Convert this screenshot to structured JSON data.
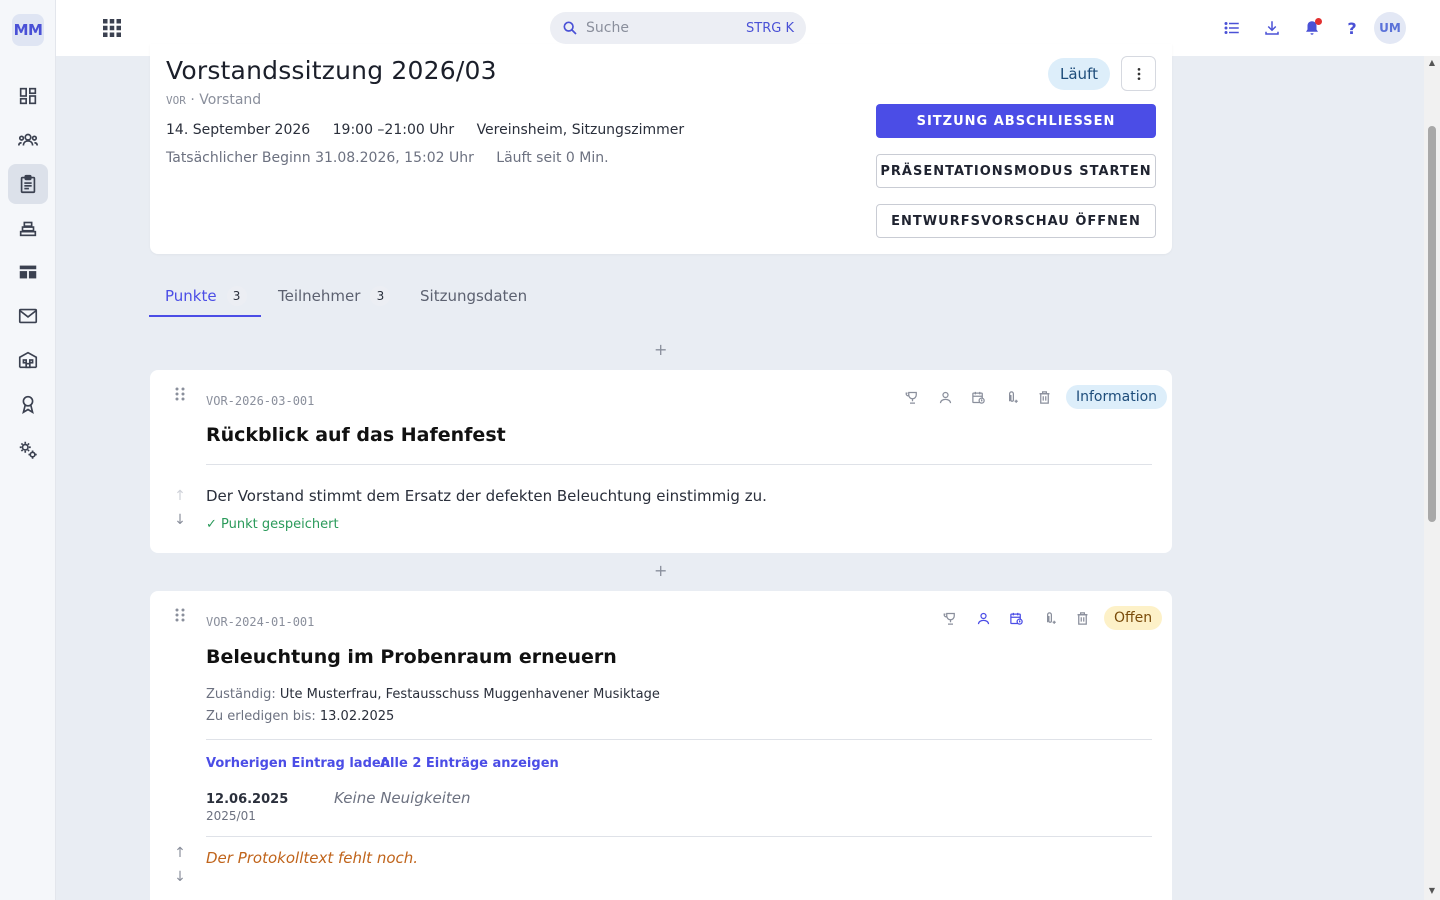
{
  "app": {
    "logo": "MM"
  },
  "sidebar": {
    "items": [
      {
        "name": "dashboard",
        "icon": "dashboard-icon"
      },
      {
        "name": "members",
        "icon": "people-icon"
      },
      {
        "name": "meetings",
        "icon": "clipboard-icon",
        "active": true
      },
      {
        "name": "inventory",
        "icon": "stack-icon"
      },
      {
        "name": "tables",
        "icon": "table-icon"
      },
      {
        "name": "mail",
        "icon": "mail-icon"
      },
      {
        "name": "buildings",
        "icon": "building-icon"
      },
      {
        "name": "awards",
        "icon": "award-icon"
      },
      {
        "name": "settings",
        "icon": "gear-icon"
      }
    ]
  },
  "topbar": {
    "search_placeholder": "Suche",
    "search_shortcut": "STRG K",
    "help": "?",
    "avatar": "UM"
  },
  "meeting": {
    "title": "Vorstandssitzung 2026/03",
    "code": "VOR",
    "group": "· Vorstand",
    "date": "14. September 2026",
    "time": "19:00 –21:00 Uhr",
    "location": "Vereinsheim, Sitzungszimmer",
    "actual_start": "Tatsächlicher Beginn 31.08.2026, 15:02 Uhr",
    "running_since": "Läuft seit 0 Min.",
    "status": "Läuft",
    "buttons": {
      "close": "SITZUNG ABSCHLIESSEN",
      "presentation": "PRÄSENTATIONSMODUS STARTEN",
      "preview": "ENTWURFSVORSCHAU ÖFFNEN"
    }
  },
  "tabs": [
    {
      "label": "Punkte",
      "count": "3"
    },
    {
      "label": "Teilnehmer",
      "count": "3"
    },
    {
      "label": "Sitzungsdaten"
    }
  ],
  "items": [
    {
      "code": "VOR-2026-03-001",
      "title": "Rückblick auf das Hafenfest",
      "tag": "Information",
      "text": "Der Vorstand stimmt dem Ersatz der defekten Beleuchtung einstimmig zu.",
      "saved": "✓ Punkt gespeichert"
    },
    {
      "code": "VOR-2024-01-001",
      "title": "Beleuchtung im Probenraum erneuern",
      "tag": "Offen",
      "responsible_label": "Zuständig:",
      "responsible": "Ute Musterfrau, Festausschuss Muggenhavener Musiktage",
      "due_label": "Zu erledigen bis:",
      "due": "13.02.2025",
      "link_prev": "Vorherigen Eintrag laden",
      "link_all": "Alle 2 Einträge anzeigen",
      "entry_date": "12.06.2025",
      "entry_num": "2025/01",
      "entry_text": "Keine Neuigkeiten",
      "missing": "Der Protokolltext fehlt noch."
    }
  ],
  "colors": {
    "accent": "#4b4de6",
    "info_chip": "#ddeefa",
    "open_chip": "#fdf1c8",
    "saved": "#2a9a5a",
    "missing": "#c0641b"
  }
}
